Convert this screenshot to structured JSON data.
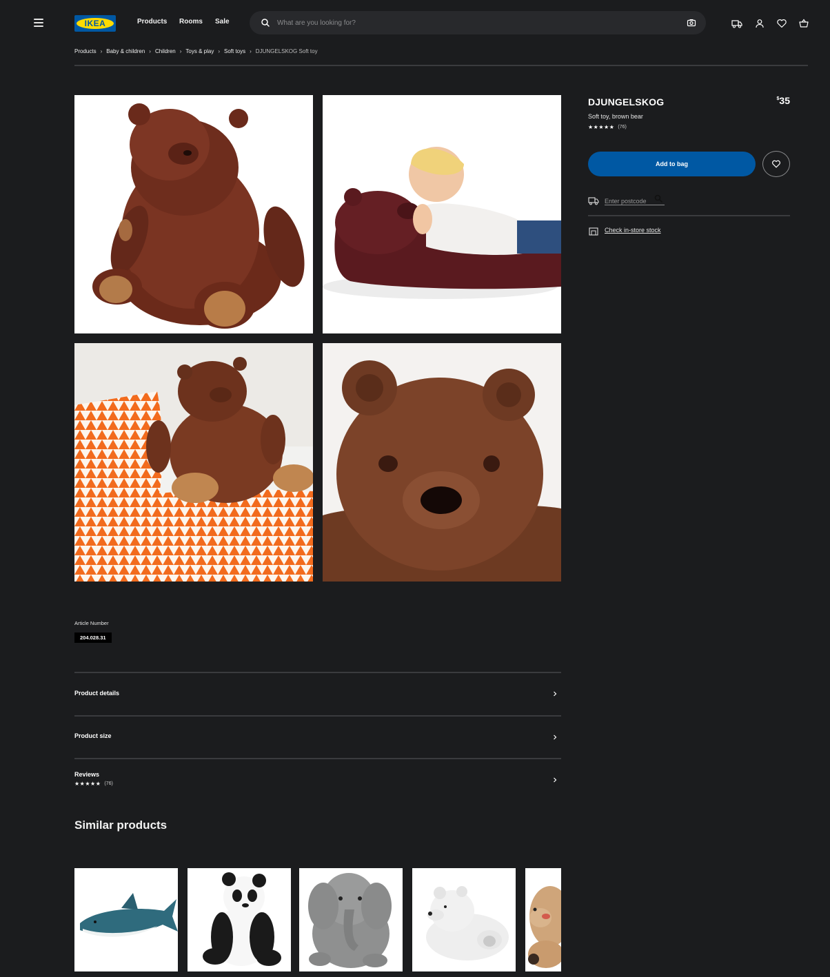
{
  "header": {
    "logo_text": "IKEA",
    "nav": [
      "Products",
      "Rooms",
      "Sale"
    ],
    "search_placeholder": "What are you looking for?"
  },
  "breadcrumb": [
    "Products",
    "Baby & children",
    "Children",
    "Toys & play",
    "Soft toys",
    "DJUNGELSKOG Soft toy"
  ],
  "product": {
    "name": "DJUNGELSKOG",
    "description": "Soft toy, brown bear",
    "price_currency": "$",
    "price_value": "35",
    "stars": "★★★★★",
    "rating_count": "(76)",
    "add_to_bag_label": "Add to bag",
    "postcode_placeholder": "Enter postcode",
    "check_stock_label": "Check in-store stock"
  },
  "article": {
    "label": "Article Number",
    "number": "204.028.31"
  },
  "accordion": {
    "details": "Product details",
    "size": "Product size",
    "reviews": "Reviews",
    "reviews_stars": "★★★★★",
    "reviews_count": "(76)"
  },
  "similar": {
    "title": "Similar products"
  },
  "colors": {
    "background": "#1b1c1e",
    "ikea_blue": "#0058a3",
    "ikea_yellow": "#ffdb00"
  }
}
